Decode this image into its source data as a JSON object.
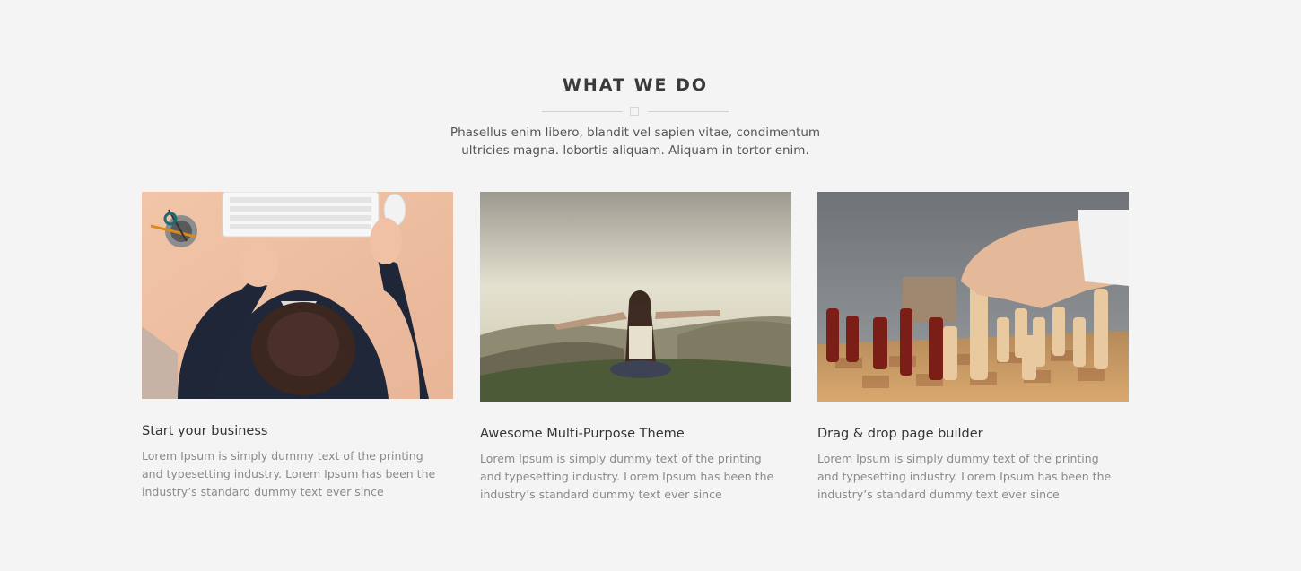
{
  "section": {
    "title": "WHAT WE DO",
    "subtitle": "Phasellus enim libero, blandit vel sapien vitae, condimentum ultricies magna. lobortis aliquam. Aliquam in tortor enim."
  },
  "cards": [
    {
      "image": "office-desk-photo",
      "title": "Start your business",
      "text": "Lorem Ipsum is simply dummy text of the printing and typesetting industry. Lorem Ipsum has been the industry’s standard dummy text ever since"
    },
    {
      "image": "woman-meditating-photo",
      "title": "Awesome Multi-Purpose Theme",
      "text": "Lorem Ipsum is simply dummy text of the printing and typesetting industry. Lorem Ipsum has been the industry’s standard dummy text ever since"
    },
    {
      "image": "chess-game-photo",
      "title": "Drag & drop page builder",
      "text": "Lorem Ipsum is simply dummy text of the printing and typesetting industry. Lorem Ipsum has been the industry’s standard dummy text ever since"
    }
  ]
}
